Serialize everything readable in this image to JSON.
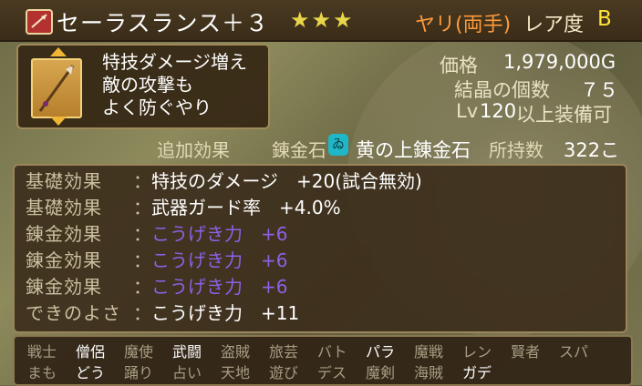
{
  "item": {
    "name": "セーラスランス＋３",
    "stars": "★★★",
    "weapon_type": "ヤリ(両手)",
    "rarity_label": "レア度",
    "rarity": "B"
  },
  "description": {
    "lines": [
      "特技ダメージ増え",
      "敵の攻撃も",
      "よく防ぐやり"
    ]
  },
  "stats": {
    "price_label": "価格",
    "price": "1,979,000G",
    "crystal_label": "結晶の個数",
    "crystal": "７５",
    "level_label": "Lv",
    "level": "120",
    "level_suffix": "以上装備可"
  },
  "extra": {
    "additional_effect_label": "追加効果",
    "alchemy_stone_label": "錬金石",
    "alchemy_stone_name": "黄の上錬金石",
    "owned_label": "所持数",
    "owned_count": "322こ"
  },
  "effects": [
    {
      "label": "基礎効果",
      "text": "特技のダメージ　+20(試合無効)",
      "color": "#ffffff"
    },
    {
      "label": "基礎効果",
      "text": "武器ガード率　+4.0%",
      "color": "#ffffff"
    },
    {
      "label": "錬金効果",
      "text": "こうげき力　+6",
      "color": "#8d60e6"
    },
    {
      "label": "錬金効果",
      "text": "こうげき力　+6",
      "color": "#8d60e6"
    },
    {
      "label": "錬金効果",
      "text": "こうげき力　+6",
      "color": "#8d60e6"
    },
    {
      "label": "できのよさ",
      "text": "こうげき力　+11",
      "color": "#ffffff"
    }
  ],
  "effect_colon": "：",
  "classes_row1": [
    {
      "name": "戦士",
      "on": false
    },
    {
      "name": "僧侶",
      "on": true
    },
    {
      "name": "魔使",
      "on": false
    },
    {
      "name": "武闘",
      "on": true
    },
    {
      "name": "盗賊",
      "on": false
    },
    {
      "name": "旅芸",
      "on": false
    },
    {
      "name": "バト",
      "on": false
    },
    {
      "name": "パラ",
      "on": true
    },
    {
      "name": "魔戦",
      "on": false
    },
    {
      "name": "レン",
      "on": false
    },
    {
      "name": "賢者",
      "on": false
    },
    {
      "name": "スパ",
      "on": false
    }
  ],
  "classes_row2": [
    {
      "name": "まも",
      "on": false
    },
    {
      "name": "どう",
      "on": true
    },
    {
      "name": "踊り",
      "on": false
    },
    {
      "name": "占い",
      "on": false
    },
    {
      "name": "天地",
      "on": false
    },
    {
      "name": "遊び",
      "on": false
    },
    {
      "name": "デス",
      "on": false
    },
    {
      "name": "魔剣",
      "on": false
    },
    {
      "name": "海賊",
      "on": false
    },
    {
      "name": "ガデ",
      "on": true
    }
  ],
  "colors": {
    "accent_orange": "#ff9a3a",
    "star_yellow": "#e8d64a",
    "rarity_yellow": "#ffe23a",
    "alchemy_purple": "#8d60e6"
  },
  "icons": {
    "weapon": "spear-icon",
    "alchemy_stone": "alchemy-stone-icon"
  }
}
